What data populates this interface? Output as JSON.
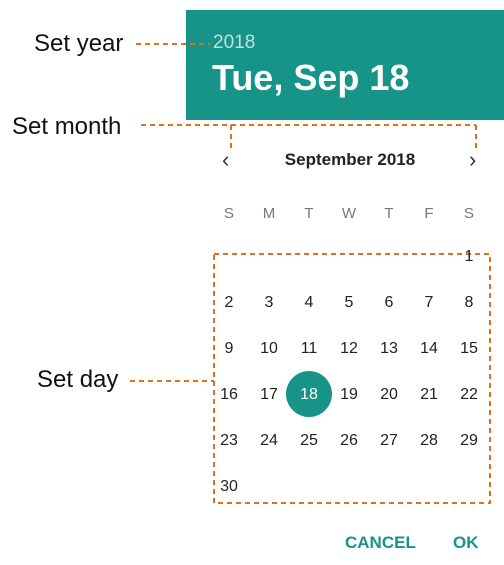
{
  "annotations": {
    "year": "Set year",
    "month": "Set month",
    "day": "Set day"
  },
  "header": {
    "year": "2018",
    "date": "Tue, Sep 18"
  },
  "calendar": {
    "month_title": "September 2018",
    "prev_icon": "‹",
    "next_icon": "›",
    "weekdays": [
      "S",
      "M",
      "T",
      "W",
      "T",
      "F",
      "S"
    ],
    "days": [
      "1",
      "2",
      "3",
      "4",
      "5",
      "6",
      "7",
      "8",
      "9",
      "10",
      "11",
      "12",
      "13",
      "14",
      "15",
      "16",
      "17",
      "18",
      "19",
      "20",
      "21",
      "22",
      "23",
      "24",
      "25",
      "26",
      "27",
      "28",
      "29",
      "30"
    ],
    "selected_day": "18"
  },
  "actions": {
    "cancel": "CANCEL",
    "ok": "OK"
  },
  "colors": {
    "accent": "#179488",
    "annotation_line": "#e07020"
  }
}
